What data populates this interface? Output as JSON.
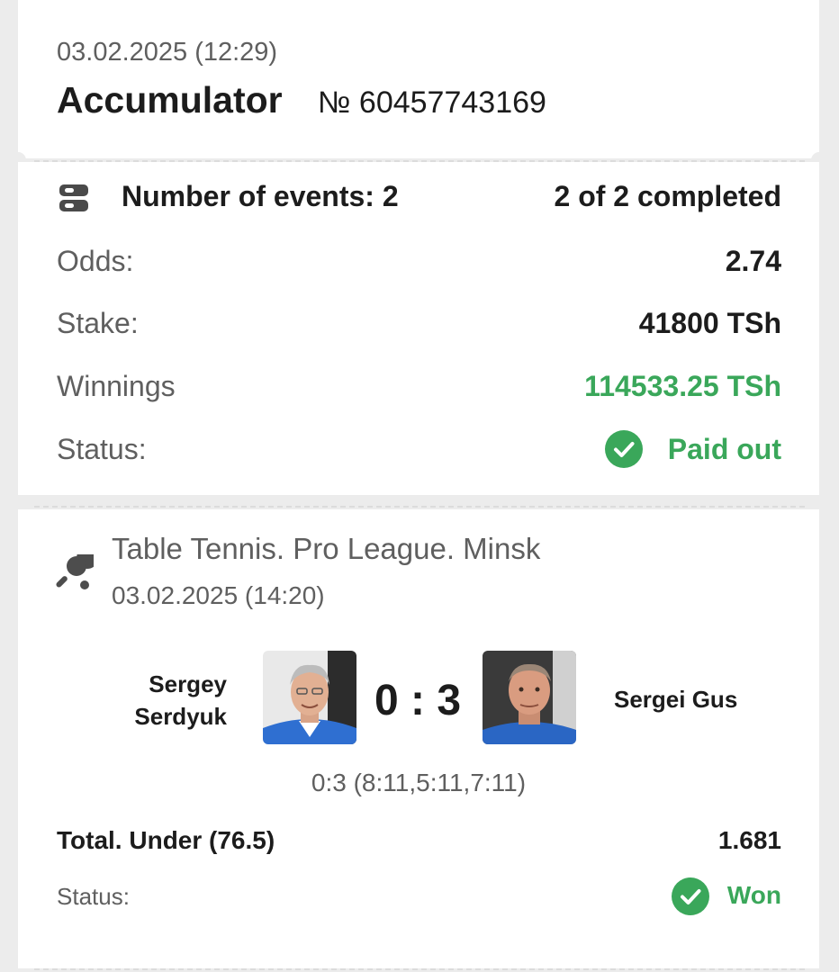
{
  "header": {
    "datetime": "03.02.2025 (12:29)",
    "bet_type": "Accumulator",
    "bet_number": "№ 60457743169"
  },
  "summary": {
    "events_label": "Number of events: 2",
    "completed": "2 of 2 completed",
    "odds_label": "Odds:",
    "odds_value": "2.74",
    "stake_label": "Stake:",
    "stake_value": "41800 TSh",
    "winnings_label": "Winnings",
    "winnings_value": "114533.25 TSh",
    "status_label": "Status:",
    "status_value": "Paid out"
  },
  "event": {
    "league": "Table Tennis. Pro League. Minsk",
    "datetime": "03.02.2025 (14:20)",
    "home_name_line1": "Sergey",
    "home_name_line2": "Serdyuk",
    "away_name": "Sergei Gus",
    "score": "0 : 3",
    "set_scores": "0:3 (8:11,5:11,7:11)",
    "market": "Total. Under (76.5)",
    "market_odds": "1.681",
    "status_label": "Status:",
    "status_value": "Won"
  },
  "icons": {
    "events": "events-list-icon",
    "sport": "table-tennis-icon",
    "status": "check-circle-icon"
  },
  "colors": {
    "success": "#3aa75a",
    "background": "#ececec",
    "card": "#ffffff"
  }
}
